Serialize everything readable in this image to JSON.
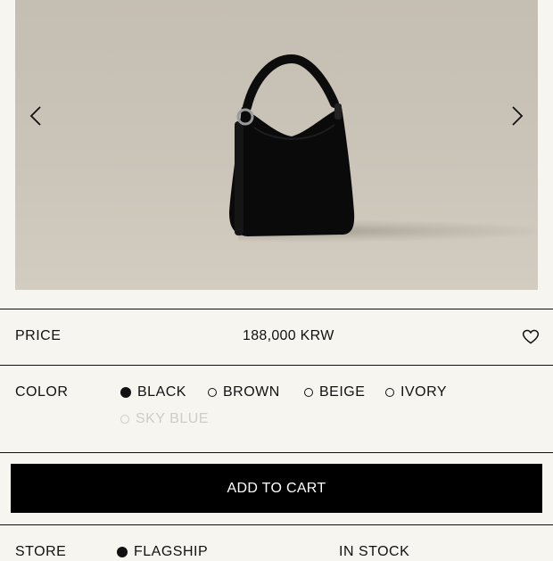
{
  "gallery": {
    "prev_icon": "chevron-left-icon",
    "next_icon": "chevron-right-icon"
  },
  "price": {
    "label": "PRICE",
    "value": "188,000 KRW",
    "wishlist_icon": "heart-icon"
  },
  "color": {
    "label": "COLOR",
    "options": [
      {
        "label": "BLACK",
        "selected": true,
        "available": true
      },
      {
        "label": "BROWN",
        "selected": false,
        "available": true
      },
      {
        "label": "BEIGE",
        "selected": false,
        "available": true
      },
      {
        "label": "IVORY",
        "selected": false,
        "available": true
      },
      {
        "label": "SKY BLUE",
        "selected": false,
        "available": false
      }
    ]
  },
  "cart": {
    "button_label": "ADD TO CART"
  },
  "store": {
    "label": "STORE",
    "option": "FLAGSHIP",
    "stock": "IN STOCK"
  },
  "colors": {
    "accent": "#000000",
    "background": "#f7f5f0",
    "disabled": "#cfccc6"
  }
}
